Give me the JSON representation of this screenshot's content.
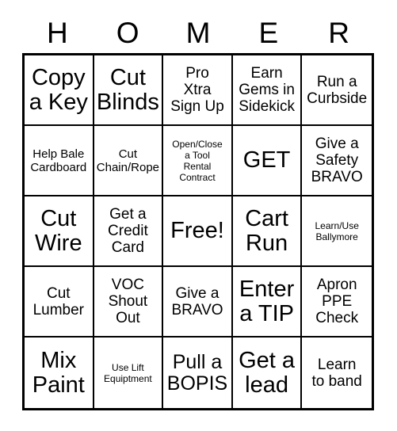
{
  "header": {
    "letters": [
      "H",
      "O",
      "M",
      "E",
      "R"
    ]
  },
  "grid": {
    "columns": 5,
    "rows": 5,
    "cells": [
      {
        "text": "Copy\na Key",
        "size": "sz-xl"
      },
      {
        "text": "Cut\nBlinds",
        "size": "sz-xl"
      },
      {
        "text": "Pro\nXtra\nSign Up",
        "size": "sz-md"
      },
      {
        "text": "Earn\nGems in\nSidekick",
        "size": "sz-md"
      },
      {
        "text": "Run a\nCurbside",
        "size": "sz-md"
      },
      {
        "text": "Help Bale\nCardboard",
        "size": "sz-sm"
      },
      {
        "text": "Cut\nChain/Rope",
        "size": "sz-sm"
      },
      {
        "text": "Open/Close\na Tool\nRental\nContract",
        "size": "sz-xs"
      },
      {
        "text": "GET",
        "size": "sz-xl"
      },
      {
        "text": "Give a\nSafety\nBRAVO",
        "size": "sz-md"
      },
      {
        "text": "Cut\nWire",
        "size": "sz-xl"
      },
      {
        "text": "Get a\nCredit\nCard",
        "size": "sz-md"
      },
      {
        "text": "Free!",
        "size": "sz-xl"
      },
      {
        "text": "Cart\nRun",
        "size": "sz-xl"
      },
      {
        "text": "Learn/Use\nBallymore",
        "size": "sz-xs"
      },
      {
        "text": "Cut\nLumber",
        "size": "sz-md"
      },
      {
        "text": "VOC\nShout\nOut",
        "size": "sz-md"
      },
      {
        "text": "Give a\nBRAVO",
        "size": "sz-md"
      },
      {
        "text": "Enter\na TIP",
        "size": "sz-xl"
      },
      {
        "text": "Apron\nPPE\nCheck",
        "size": "sz-md"
      },
      {
        "text": "Mix\nPaint",
        "size": "sz-xl"
      },
      {
        "text": "Use Lift\nEquiptment",
        "size": "sz-xs"
      },
      {
        "text": "Pull a\nBOPIS",
        "size": "sz-lg"
      },
      {
        "text": "Get a\nlead",
        "size": "sz-xl"
      },
      {
        "text": "Learn\nto band",
        "size": "sz-md"
      }
    ]
  },
  "colors": {
    "background": "#ffffff",
    "ink": "#000000",
    "grid_line": "#000000"
  }
}
